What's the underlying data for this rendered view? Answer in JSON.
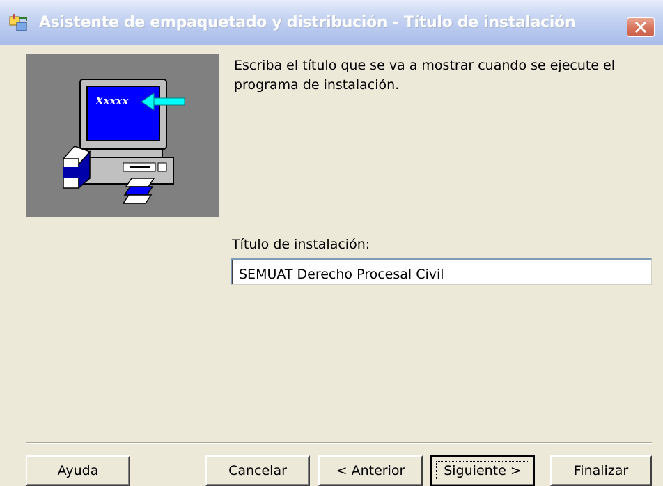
{
  "window": {
    "title": "Asistente de empaquetado y distribución - Título de instalación"
  },
  "content": {
    "instructions": "Escriba el título que se va a mostrar cuando se ejecute el programa de instalación.",
    "field_label": "Título de instalación:",
    "field_value": "SEMUAT Derecho Procesal Civil",
    "picture_screen_text": "Xxxxx"
  },
  "buttons": {
    "help": "Ayuda",
    "cancel": "Cancelar",
    "back": "< Anterior",
    "next": "Siguiente >",
    "finish": "Finalizar"
  },
  "colors": {
    "titlebar": "#b6c7ee",
    "picture_bg": "#808080",
    "screen": "#0000ff",
    "arrow": "#00ffff"
  }
}
